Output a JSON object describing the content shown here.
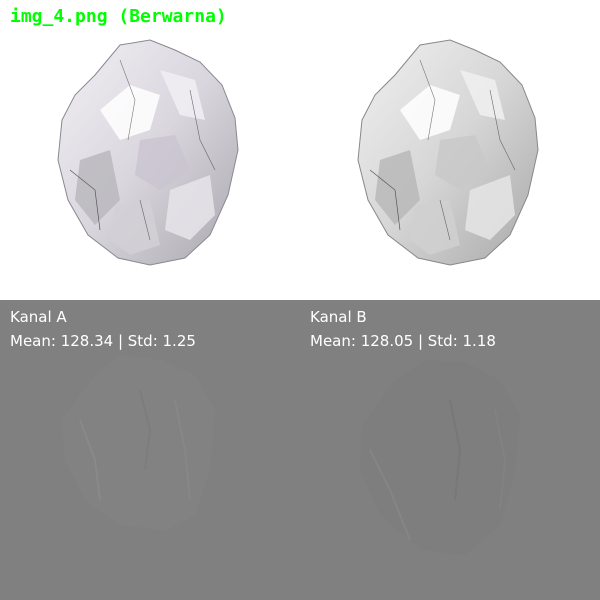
{
  "panels": {
    "color": {
      "title": "img_4.png (Berwarna)"
    },
    "gray": {},
    "channel_a": {
      "label": "Kanal A",
      "stats": "Mean: 128.34 | Std: 1.25"
    },
    "channel_b": {
      "label": "Kanal B",
      "stats": "Mean: 128.05 | Std: 1.18"
    }
  },
  "colors": {
    "title_text": "#00ff00",
    "channel_bg": "#808080",
    "label_text": "#ffffff"
  }
}
